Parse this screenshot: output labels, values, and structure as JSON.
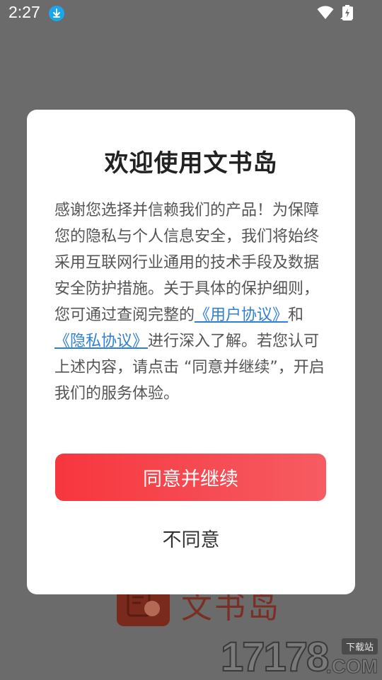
{
  "status_bar": {
    "time": "2:27",
    "icons": [
      "download-icon",
      "wifi-icon",
      "signal-icon",
      "battery-icon"
    ]
  },
  "background": {
    "app_logo_text": "文书岛"
  },
  "dialog": {
    "title": "欢迎使用文书岛",
    "body_part1": "感谢您选择并信赖我们的产品！为保障您的隐私与个人信息安全，我们将始终采用互联网行业通用的技术手段及数据安全防护措施。关于具体的保护细则，您可通过查阅完整的",
    "user_agreement_link": "《用户协议》",
    "and": "和",
    "privacy_link": "《隐私协议》",
    "body_part2": "进行深入了解。若您认可上述内容，请点击 “同意并继续”，开启我们的服务体验。",
    "agree_label": "同意并继续",
    "disagree_label": "不同意"
  },
  "watermark": {
    "digits": "17178",
    "badge": "下载站",
    "domain": ".COM"
  },
  "colors": {
    "accent_red": "#f7363e",
    "link_blue": "#2f7fd6",
    "overlay": "#6b6b6b"
  }
}
